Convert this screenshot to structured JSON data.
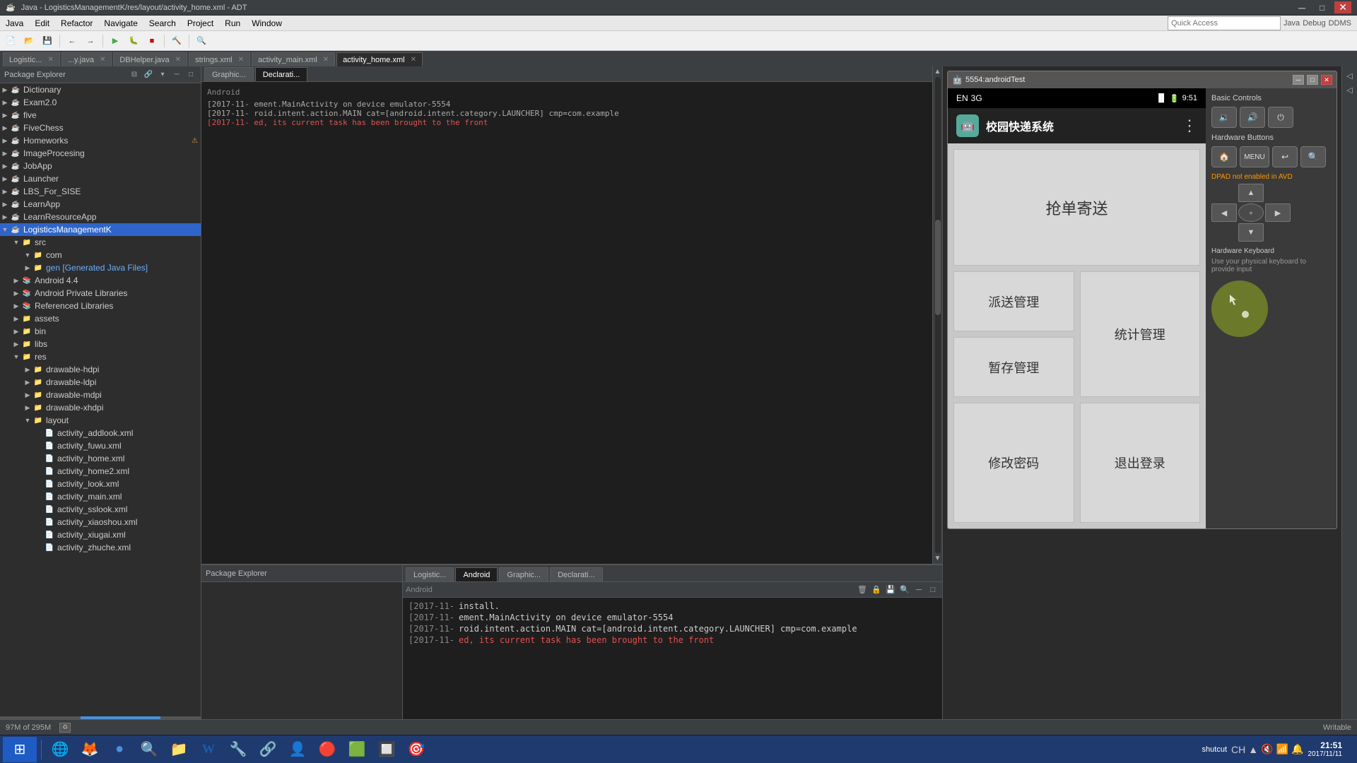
{
  "window": {
    "title": "Java - LogisticsManagementK/res/layout/activity_home.xml - ADT"
  },
  "menubar": {
    "items": [
      "Java",
      "Edit",
      "Refactor",
      "Navigate",
      "Search",
      "Project",
      "Run",
      "Window"
    ]
  },
  "quickaccess": {
    "label": "Quick Access",
    "placeholder": "Quick Access"
  },
  "toolbar_tabs": {
    "rightBtns": [
      "Java",
      "Debug",
      "DDMS"
    ]
  },
  "editor_tabs": [
    {
      "label": "Logistic...",
      "active": false
    },
    {
      "label": "...y.java",
      "active": false
    },
    {
      "label": "DBHelper.java",
      "active": false
    },
    {
      "label": "strings.xml",
      "active": false
    },
    {
      "label": "activity_main.xml",
      "active": false
    },
    {
      "label": "activity_home.xml",
      "active": true
    }
  ],
  "package_explorer": {
    "title": "Package Explorer",
    "tree": [
      {
        "label": "Dictionary",
        "indent": 0,
        "type": "project",
        "expanded": true
      },
      {
        "label": "Exam2.0",
        "indent": 0,
        "type": "project",
        "expanded": false
      },
      {
        "label": "five",
        "indent": 0,
        "type": "project",
        "expanded": false
      },
      {
        "label": "FiveChess",
        "indent": 0,
        "type": "project",
        "expanded": false
      },
      {
        "label": "Homeworks",
        "indent": 0,
        "type": "project",
        "expanded": false,
        "warn": true
      },
      {
        "label": "ImageProcesing",
        "indent": 0,
        "type": "project",
        "expanded": false
      },
      {
        "label": "JobApp",
        "indent": 0,
        "type": "project",
        "expanded": false
      },
      {
        "label": "Launcher",
        "indent": 0,
        "type": "project",
        "expanded": false
      },
      {
        "label": "LBS_For_SISE",
        "indent": 0,
        "type": "project",
        "expanded": false
      },
      {
        "label": "LearnApp",
        "indent": 0,
        "type": "project",
        "expanded": false
      },
      {
        "label": "LearnResourceApp",
        "indent": 0,
        "type": "project",
        "expanded": false
      },
      {
        "label": "LogisticsManagementK",
        "indent": 0,
        "type": "project",
        "expanded": true
      },
      {
        "label": "src",
        "indent": 1,
        "type": "folder",
        "expanded": true
      },
      {
        "label": "com",
        "indent": 2,
        "type": "folder",
        "expanded": true
      },
      {
        "label": "gen [Generated Java Files]",
        "indent": 2,
        "type": "folder",
        "expanded": false,
        "blue": true
      },
      {
        "label": "Android 4.4",
        "indent": 1,
        "type": "lib",
        "expanded": false
      },
      {
        "label": "Android Private Libraries",
        "indent": 1,
        "type": "lib",
        "expanded": false
      },
      {
        "label": "Referenced Libraries",
        "indent": 1,
        "type": "lib",
        "expanded": false
      },
      {
        "label": "assets",
        "indent": 1,
        "type": "folder",
        "expanded": false
      },
      {
        "label": "bin",
        "indent": 1,
        "type": "folder",
        "expanded": false
      },
      {
        "label": "libs",
        "indent": 1,
        "type": "folder",
        "expanded": false
      },
      {
        "label": "res",
        "indent": 1,
        "type": "folder",
        "expanded": true
      },
      {
        "label": "drawable-hdpi",
        "indent": 2,
        "type": "folder",
        "expanded": false
      },
      {
        "label": "drawable-ldpi",
        "indent": 2,
        "type": "folder",
        "expanded": false
      },
      {
        "label": "drawable-mdpi",
        "indent": 2,
        "type": "folder",
        "expanded": false
      },
      {
        "label": "drawable-xhdpi",
        "indent": 2,
        "type": "folder",
        "expanded": false
      },
      {
        "label": "layout",
        "indent": 2,
        "type": "folder",
        "expanded": true
      },
      {
        "label": "activity_addlook.xml",
        "indent": 3,
        "type": "file"
      },
      {
        "label": "activity_fuwu.xml",
        "indent": 3,
        "type": "file"
      },
      {
        "label": "activity_home.xml",
        "indent": 3,
        "type": "file"
      },
      {
        "label": "activity_home2.xml",
        "indent": 3,
        "type": "file"
      },
      {
        "label": "activity_look.xml",
        "indent": 3,
        "type": "file"
      },
      {
        "label": "activity_main.xml",
        "indent": 3,
        "type": "file"
      },
      {
        "label": "activity_sslook.xml",
        "indent": 3,
        "type": "file"
      },
      {
        "label": "activity_xiaoshou.xml",
        "indent": 3,
        "type": "file"
      },
      {
        "label": "activity_xiugai.xml",
        "indent": 3,
        "type": "file"
      },
      {
        "label": "activity_zhuche.xml",
        "indent": 3,
        "type": "file"
      }
    ]
  },
  "emulator": {
    "title": "5554:androidTest",
    "statusbar": {
      "lang": "EN",
      "signal": "3G",
      "time": "9:51"
    },
    "app": {
      "name": "校园快递系统",
      "buttons": {
        "row1": [
          "抢单寄送"
        ],
        "row2_left": [
          "派送管理",
          "暂存管理"
        ],
        "row2_right": [
          "统计管理"
        ],
        "row3_left": [
          "修改密码"
        ],
        "row3_right": [
          "退出登录"
        ]
      }
    },
    "controls": {
      "basic_title": "Basic Controls",
      "hardware_buttons_title": "Hardware Buttons",
      "dpad_note": "DPAD not enabled in AVD",
      "keyboard_title": "Hardware Keyboard",
      "keyboard_note": "Use your physical keyboard to provide input"
    }
  },
  "console": {
    "tabs": [
      "Android",
      "Graphic...",
      "Declarati..."
    ],
    "active_tab": "Android",
    "log_entries": [
      {
        "timestamp": "[2017-11-",
        "text": "Android",
        "type": "normal"
      },
      {
        "timestamp": "[2017-11-",
        "text": "ement.MainActivity on device emulator-5554",
        "type": "normal"
      },
      {
        "timestamp": "[2017-11-",
        "text": "roid.intent.action.MAIN cat=[android.intent.category.LAUNCHER] cmp=com.example",
        "type": "normal"
      },
      {
        "timestamp": "[2017-11-",
        "text": "ed, its current task has been brought to the front",
        "type": "red"
      }
    ],
    "install_text": "install.",
    "memory": "97M of 295M"
  },
  "taskbar": {
    "apps": [
      {
        "name": "windows-start",
        "icon": "⊞"
      },
      {
        "name": "ie-browser",
        "icon": "🌐"
      },
      {
        "name": "firefox",
        "icon": "🦊"
      },
      {
        "name": "chrome",
        "icon": "●"
      },
      {
        "name": "search",
        "icon": "🔍"
      },
      {
        "name": "files",
        "icon": "📁"
      },
      {
        "name": "word",
        "icon": "W"
      },
      {
        "name": "app7",
        "icon": "🔧"
      },
      {
        "name": "app8",
        "icon": "🔗"
      },
      {
        "name": "app9",
        "icon": "👤"
      },
      {
        "name": "app10",
        "icon": "🔴"
      },
      {
        "name": "app11",
        "icon": "🟩"
      },
      {
        "name": "app12",
        "icon": "🔲"
      },
      {
        "name": "app13",
        "icon": "🎯"
      }
    ],
    "sys_tray": "shutcut",
    "time": "21:51",
    "date": "2017/11/11"
  }
}
